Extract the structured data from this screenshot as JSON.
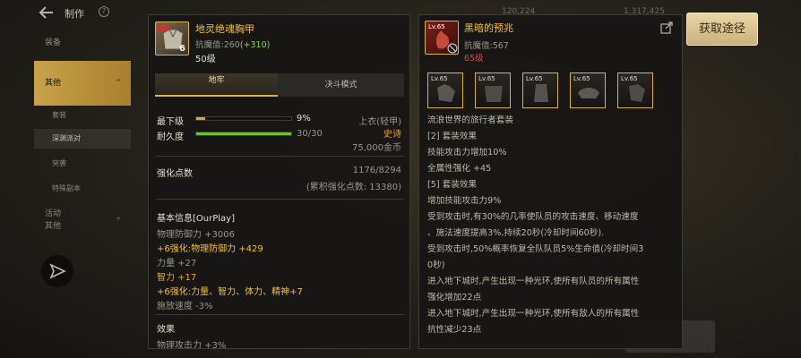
{
  "app": {
    "title": "制作",
    "help_glyph": "?",
    "top_stat_1": "120,224",
    "top_stat_2": "1,317,425",
    "acquire_button": "获取途径"
  },
  "sidebar": {
    "items": [
      {
        "label": "装备"
      },
      {
        "label": "其他"
      },
      {
        "label": "套装"
      },
      {
        "label": "深渊派对"
      },
      {
        "label": "突袭"
      },
      {
        "label": "特殊副本"
      },
      {
        "label": "活动"
      },
      {
        "label": "其他"
      }
    ]
  },
  "left_panel": {
    "item_name": "地灵绝魂胸甲",
    "icon_badge": "6",
    "resist_label": "抗魔值:260",
    "resist_bonus": "(+310)",
    "level": "50级",
    "tabs": [
      {
        "label": "地牢"
      },
      {
        "label": "决斗模式"
      }
    ],
    "stats": [
      {
        "label": "最下级",
        "value": "9%",
        "extra": "上衣(轻甲)",
        "fill": 0.09
      },
      {
        "label": "耐久度",
        "value": "30/30",
        "extra": "史诗",
        "fill": 1.0
      }
    ],
    "price": "75,000金币",
    "enhance_label": "强化点数",
    "enhance_value": "1176/8294",
    "enhance_accum": "(累积强化点数: 13380)",
    "basic_info_header": "基本信息[OurPlay]",
    "basic_lines": [
      {
        "text": "物理防御力 +3006",
        "color": "muted"
      },
      {
        "text": "+6强化:物理防御力 +429",
        "color": "gold"
      },
      {
        "text": "力量 +27",
        "color": "muted"
      },
      {
        "text": "智力 +17",
        "color": "orange"
      },
      {
        "text": "+6强化:力量、智力、体力、精神+7",
        "color": "gold"
      },
      {
        "text": "施放速度 -3%",
        "color": "muted"
      }
    ],
    "effect_header": "效果",
    "effect_partial": "物理攻击力 +3%"
  },
  "right_panel": {
    "item_name": "黑暗的预兆",
    "icon_level": "Lv.65",
    "resist": "抗魔值:567",
    "level": "65级",
    "set_items": [
      {
        "lv": "Lv.65"
      },
      {
        "lv": "Lv.65"
      },
      {
        "lv": "Lv.65"
      },
      {
        "lv": "Lv.65"
      },
      {
        "lv": "Lv.65"
      }
    ],
    "lines": [
      "流浪世界的旅行者套装",
      "[2] 套装效果",
      "技能攻击力增加10%",
      "全属性强化 +45",
      "[5] 套装效果",
      "增加技能攻击力9%",
      "受到攻击时,有30%的几率使队员的攻击速度、移动速度",
      "、施法速度提高3%,持续20秒(冷却时间60秒).",
      "受到攻击时,50%概率恢复全队队员5%生命值(冷却时间3",
      "0秒)",
      "进入地下城时,产生出现一种光环,使所有队员的所有属性",
      "强化增加22点",
      "进入地下城时,产生出现一种光环,使所有敌人的所有属性",
      "抗性减少23点"
    ]
  }
}
